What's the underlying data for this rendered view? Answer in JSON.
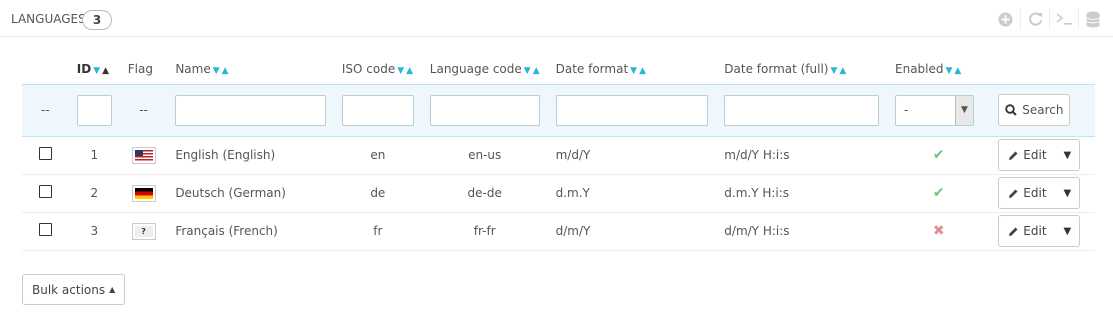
{
  "panel": {
    "title": "Languages",
    "count": "3"
  },
  "header_icons": [
    "add-icon",
    "refresh-icon",
    "sql-query-icon",
    "database-icon"
  ],
  "columns": {
    "id": "ID",
    "flag": "Flag",
    "name": "Name",
    "iso": "ISO code",
    "lang_code": "Language code",
    "date_format": "Date format",
    "date_format_full": "Date format (full)",
    "enabled": "Enabled"
  },
  "filters": {
    "checkbox_placeholder": "--",
    "flag_placeholder": "--",
    "enabled_selected": "-",
    "search_label": "Search"
  },
  "rows": [
    {
      "id": "1",
      "flag": "us",
      "name": "English (English)",
      "iso": "en",
      "lang_code": "en-us",
      "date_format": "m/d/Y",
      "date_format_full": "m/d/Y H:i:s",
      "enabled": true,
      "edit_label": "Edit"
    },
    {
      "id": "2",
      "flag": "de",
      "name": "Deutsch (German)",
      "iso": "de",
      "lang_code": "de-de",
      "date_format": "d.m.Y",
      "date_format_full": "d.m.Y H:i:s",
      "enabled": true,
      "edit_label": "Edit"
    },
    {
      "id": "3",
      "flag": "unknown",
      "name": "Français (French)",
      "iso": "fr",
      "lang_code": "fr-fr",
      "date_format": "d/m/Y",
      "date_format_full": "d/m/Y H:i:s",
      "enabled": false,
      "edit_label": "Edit"
    }
  ],
  "flag_unknown_glyph": "?",
  "bulk_actions_label": "Bulk actions",
  "colors": {
    "accent": "#25b9d7",
    "enabled": "#72c279",
    "disabled": "#e08f95",
    "filter_bg": "#eef8fc"
  }
}
